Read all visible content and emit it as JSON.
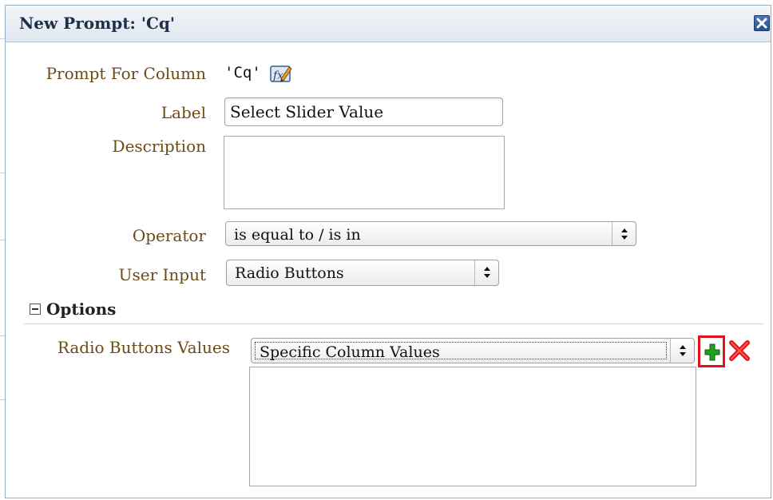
{
  "dialog": {
    "title": "New Prompt: 'Cq'",
    "close_icon": "close-icon"
  },
  "form": {
    "prompt_for_column_label": "Prompt For Column",
    "prompt_for_column_value": "'Cq'",
    "edit_formula_icon": "edit-formula-icon",
    "label_label": "Label",
    "label_value": "Select Slider Value",
    "description_label": "Description",
    "description_value": "",
    "operator_label": "Operator",
    "operator_value": "is equal to / is in",
    "user_input_label": "User Input",
    "user_input_value": "Radio Buttons"
  },
  "options": {
    "title": "Options",
    "radio_buttons_values_label": "Radio Buttons Values",
    "radio_buttons_values_selected": "Specific Column Values",
    "add_icon": "add-icon",
    "delete_icon": "delete-icon",
    "values_list": []
  },
  "colors": {
    "label_text": "#6b4a17",
    "title_text": "#1f2f4a",
    "add_green": "#1ea11e",
    "delete_red": "#e0141c",
    "highlight_red": "#e0141c"
  }
}
